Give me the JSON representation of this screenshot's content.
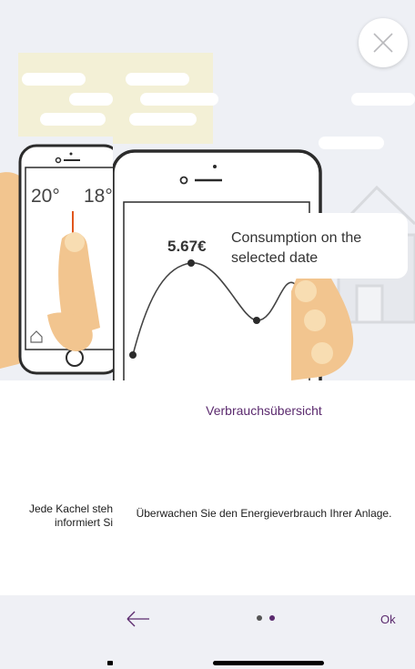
{
  "colors": {
    "accent": "#5b2a6e",
    "background_illustration": "#eef0f5",
    "bottom_bar": "#eff0f5",
    "skin": "#f2c58f",
    "skin_light": "#f8ddb2",
    "dot_inactive": "#555555",
    "dot_active": "#5b2a6e"
  },
  "previous_slide": {
    "caption_line1": "Jede Kachel steh",
    "caption_line2": "informiert Si",
    "phone": {
      "temp_primary": "20°",
      "temp_secondary": "18°",
      "home_icon": "home-icon"
    }
  },
  "current_slide": {
    "tooltip_value": "5.67€",
    "tooltip_text_line1": "Consumption on the",
    "tooltip_text_line2": "selected date",
    "title": "Verbrauchsübersicht",
    "description": "Überwachen Sie den Energieverbrauch Ihrer Anlage."
  },
  "close_button": {
    "icon": "close-icon"
  },
  "navigation": {
    "back_icon": "arrow-left-icon",
    "page_indicator": {
      "total": 2,
      "current": 2
    },
    "ok_label": "Ok"
  }
}
